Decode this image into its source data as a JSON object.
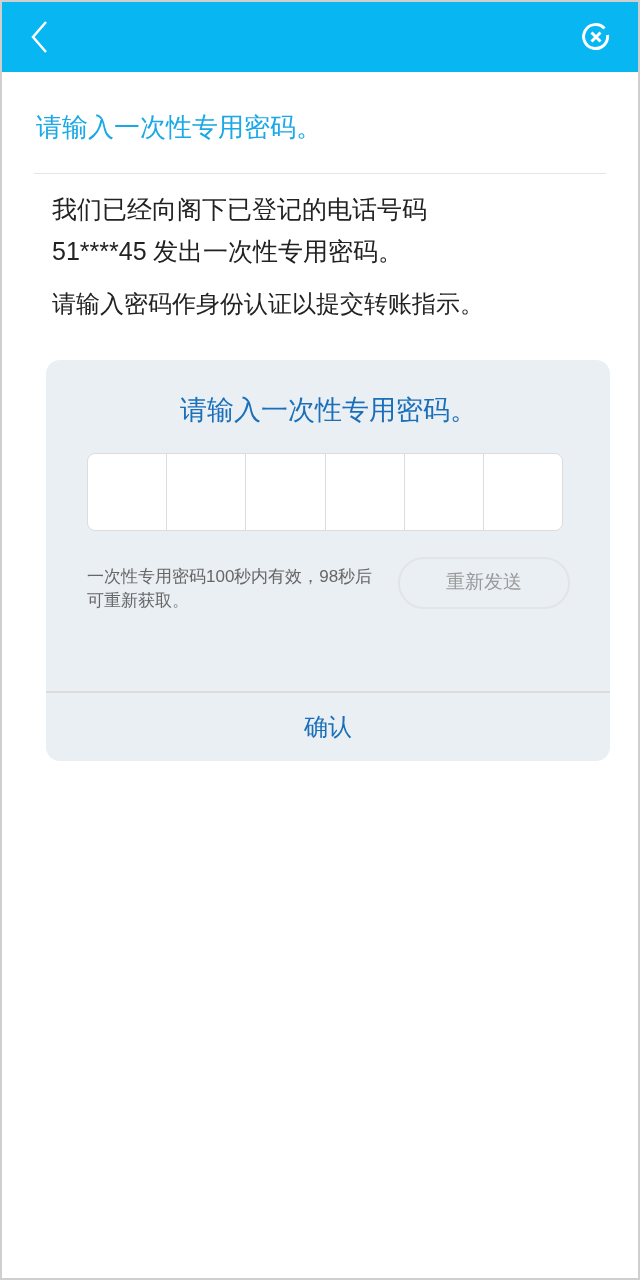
{
  "heading": "请输入一次性专用密码。",
  "message": "我们已经向阁下已登记的电话号码 51****45 发出一次性专用密码。",
  "instruction": "请输入密码作身份认证以提交转账指示。",
  "otp_card": {
    "title": "请输入一次性专用密码。",
    "digits": [
      {
        "filled": false
      },
      {
        "filled": false
      },
      {
        "filled": false
      },
      {
        "filled": false
      },
      {
        "filled": false
      },
      {
        "filled": false
      }
    ],
    "hint": "一次性专用密码100秒内有效，98秒后可重新获取。",
    "resend_button": {
      "label": "重新发送",
      "disabled": true
    },
    "confirm_button": {
      "label": "确认"
    }
  }
}
